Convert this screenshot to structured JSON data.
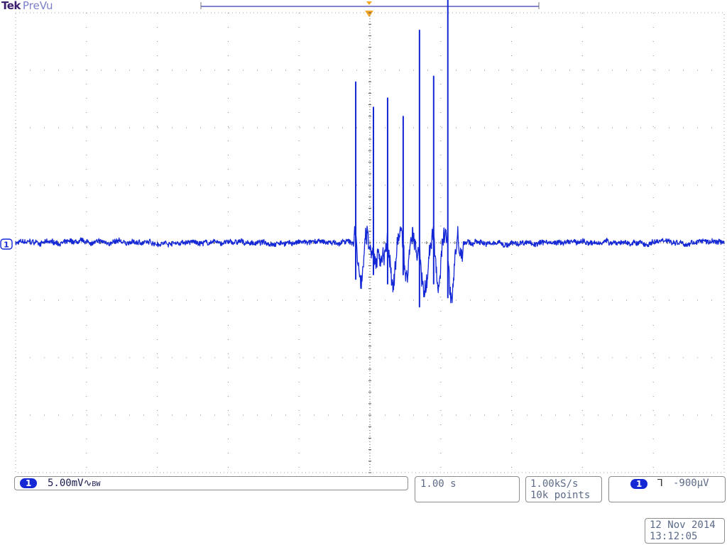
{
  "header": {
    "brand": "Tek",
    "mode": "PreVu"
  },
  "channel_marker": "1",
  "ch1": {
    "label": "1",
    "scale": "5.00mV",
    "coupling_glyph": "∿",
    "bw_glyph": "BW"
  },
  "timebase": {
    "value": "1.00 s"
  },
  "acquisition": {
    "rate": "1.00kS/s",
    "points": "10k points"
  },
  "trigger": {
    "source": "1",
    "slope_glyph": "⅂",
    "level": "-900µV"
  },
  "timestamp": {
    "date": "12 Nov 2014",
    "time": "13:12:05"
  },
  "colors": {
    "trace": "#1428d6",
    "grid_dots": "#8a8a8a",
    "trigger_marker": "#f5a623",
    "brand": "#3b1e6e"
  },
  "chart_data": {
    "type": "line",
    "title": "",
    "xlabel": "",
    "ylabel": "",
    "x_unit": "s",
    "y_unit": "mV",
    "xlim": [
      -5.0,
      5.0
    ],
    "ylim": [
      -20.0,
      20.0
    ],
    "x_divisions": 10,
    "y_divisions": 8,
    "grid": true,
    "baseline_mV": 0.0,
    "noise_amplitude_mV": 0.2,
    "series": [
      {
        "baseline_mV": 0.0,
        "spikes": [
          {
            "t": -0.2,
            "peak": 14.0,
            "dip": -4.0
          },
          {
            "t": 0.05,
            "peak": 11.8,
            "dip": -3.5
          },
          {
            "t": 0.25,
            "peak": 12.6,
            "dip": -4.5
          },
          {
            "t": 0.47,
            "peak": 11.0,
            "dip": -3.5
          },
          {
            "t": 0.7,
            "peak": 18.5,
            "dip": -7.0
          },
          {
            "t": 0.9,
            "peak": 14.5,
            "dip": -4.5
          },
          {
            "t": 1.1,
            "peak": 23.0,
            "dip": -6.0
          }
        ]
      }
    ]
  }
}
